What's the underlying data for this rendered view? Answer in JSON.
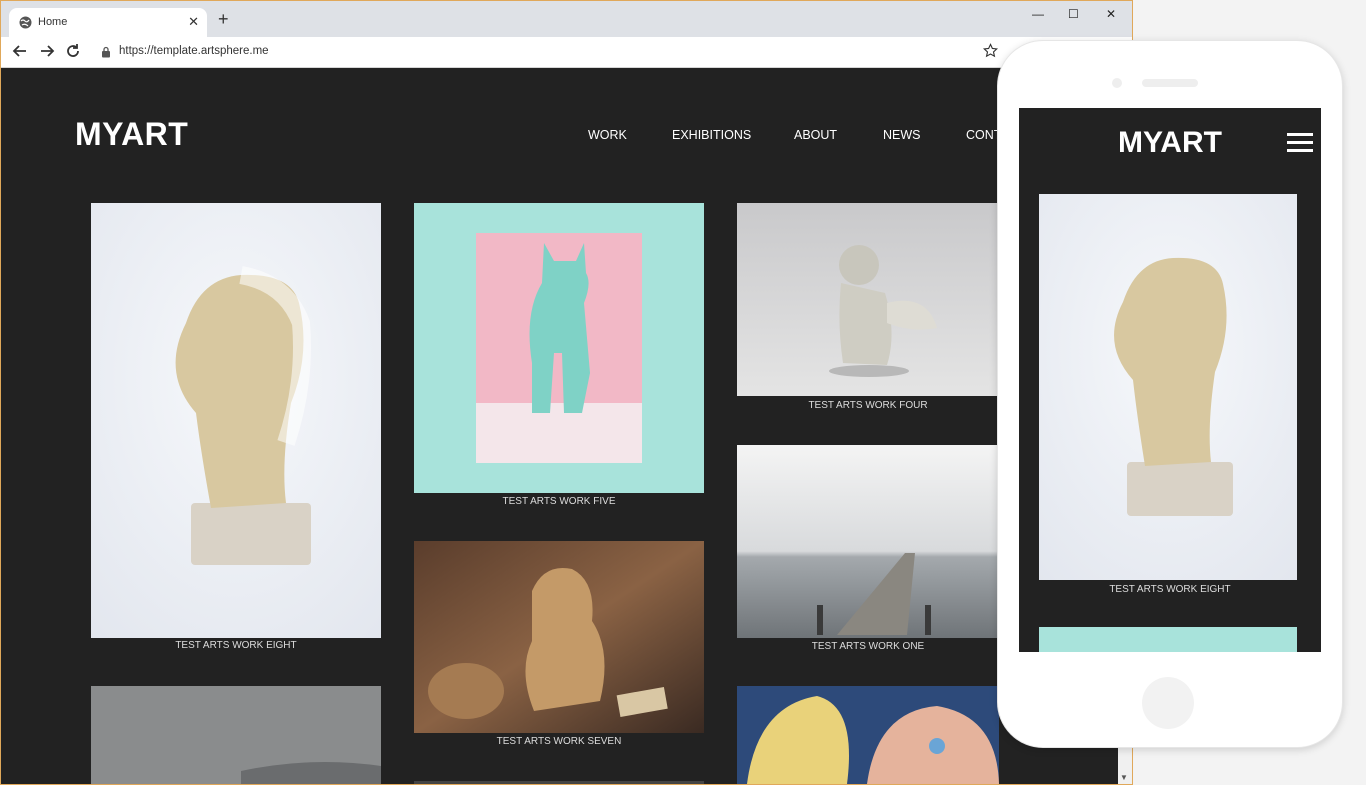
{
  "browser": {
    "tab_title": "Home",
    "tab_close": "✕",
    "new_tab": "+",
    "url": "https://template.artsphere.me",
    "window_controls": [
      "—",
      "☐",
      "✕"
    ]
  },
  "site": {
    "logo": "MYART",
    "nav": [
      "WORK",
      "EXHIBITIONS",
      "ABOUT",
      "NEWS",
      "CONT"
    ],
    "works": [
      {
        "caption": "TEST ARTS WORK EIGHT",
        "subject": "white torso sculpture"
      },
      {
        "caption": "TEST ARTS WORK FIVE",
        "subject": "mint cat figurine on pink card"
      },
      {
        "caption": "TEST ARTS WORK FOUR",
        "subject": "cherub statue"
      },
      {
        "caption": "TEST ARTS WORK SEVEN",
        "subject": "carved wooden figures"
      },
      {
        "caption": "TEST ARTS WORK ONE",
        "subject": "pier in fog"
      }
    ]
  },
  "mobile": {
    "logo": "MYART",
    "caption": "TEST ARTS WORK EIGHT"
  }
}
